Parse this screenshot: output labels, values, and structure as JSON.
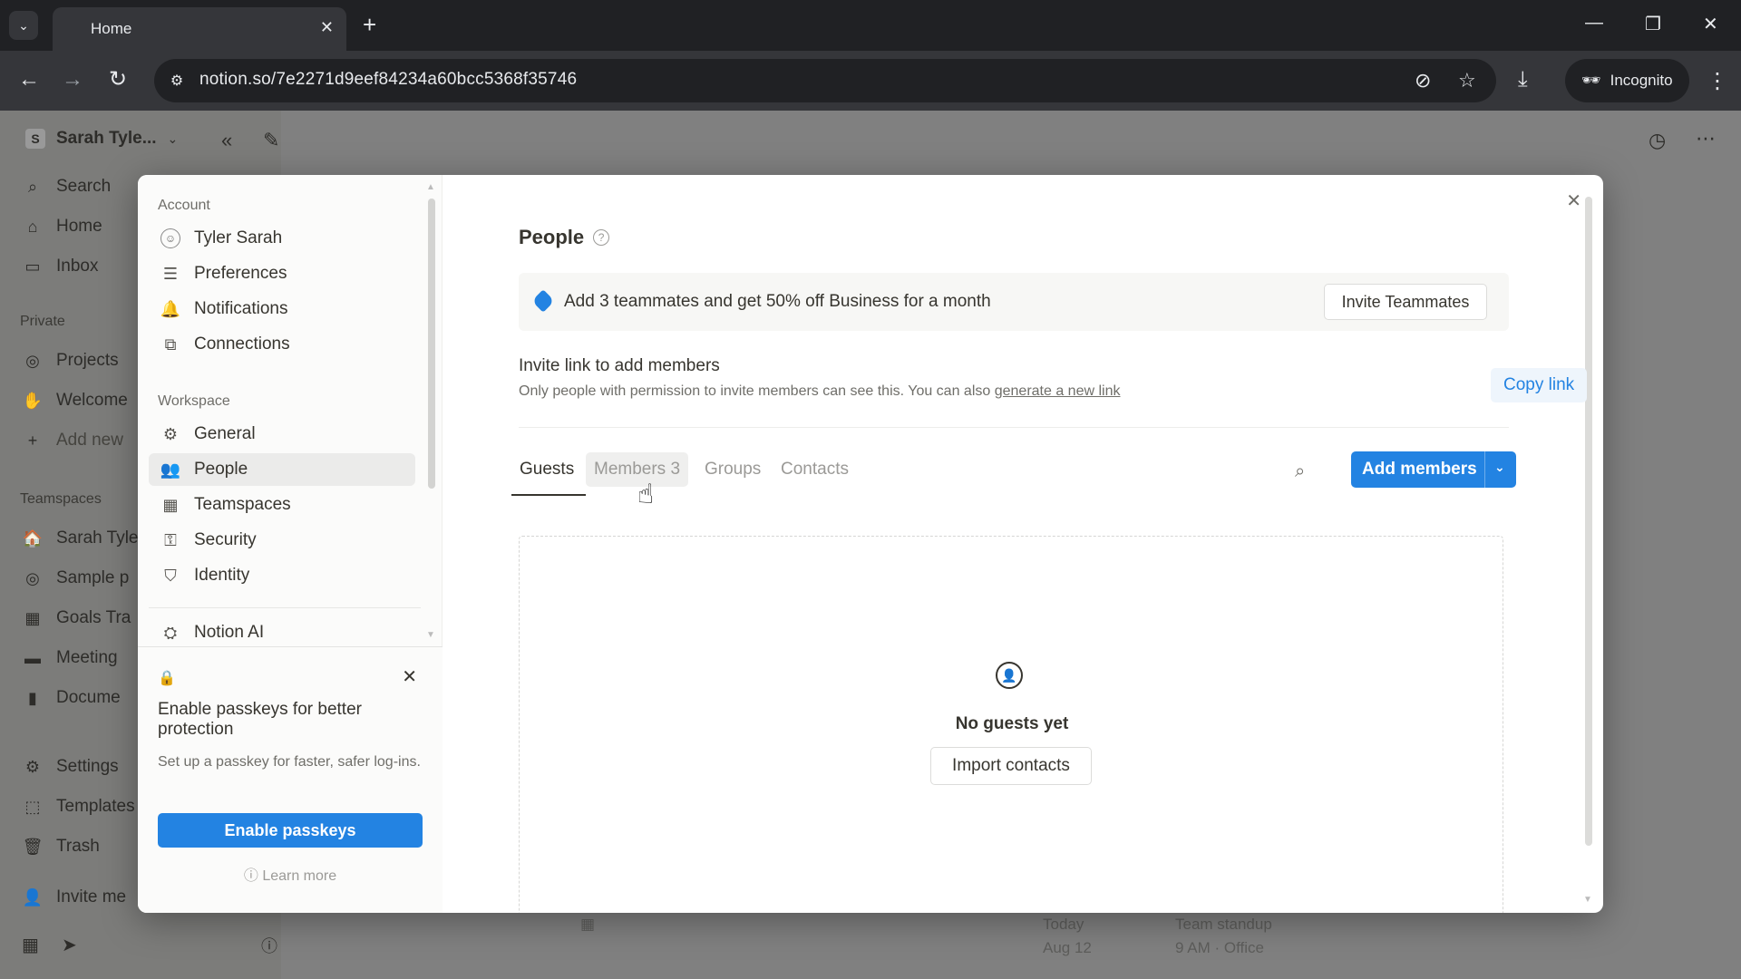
{
  "browser": {
    "tab_title": "Home",
    "url": "notion.so/7e2271d9eef84234a60bcc5368f35746",
    "incognito_label": "Incognito"
  },
  "notion_sidebar": {
    "workspace_name": "Sarah Tyle...",
    "workspace_initial": "S",
    "items": [
      {
        "label": "Search",
        "icon": "search-icon"
      },
      {
        "label": "Home",
        "icon": "home-icon"
      },
      {
        "label": "Inbox",
        "icon": "inbox-icon"
      }
    ],
    "private_label": "Private",
    "private_items": [
      {
        "label": "Projects",
        "icon": "projects-icon"
      },
      {
        "label": "Welcome",
        "icon": "wave-icon"
      },
      {
        "label": "Add new",
        "icon": "plus-icon"
      }
    ],
    "teamspaces_label": "Teamspaces",
    "teamspace_items": [
      {
        "label": "Sarah Tyle",
        "icon": "house-icon"
      },
      {
        "label": "Sample p",
        "icon": "sample-icon"
      },
      {
        "label": "Goals Tra",
        "icon": "chart-icon"
      },
      {
        "label": "Meeting",
        "icon": "folder-icon"
      },
      {
        "label": "Docume",
        "icon": "doc-icon"
      }
    ],
    "bottom_items": [
      {
        "label": "Settings",
        "icon": "gear-icon"
      },
      {
        "label": "Templates",
        "icon": "templates-icon"
      },
      {
        "label": "Trash",
        "icon": "trash-icon"
      },
      {
        "label": "Invite me",
        "icon": "invite-icon"
      }
    ]
  },
  "background_calendar": {
    "today": "Today",
    "date": "Aug 12",
    "event": "Team standup",
    "event_meta": "9 AM · Office"
  },
  "settings_modal": {
    "account_label": "Account",
    "account_items": [
      {
        "label": "Tyler Sarah",
        "icon": "avatar-icon"
      },
      {
        "label": "Preferences",
        "icon": "sliders-icon"
      },
      {
        "label": "Notifications",
        "icon": "bell-icon"
      },
      {
        "label": "Connections",
        "icon": "external-link-icon"
      }
    ],
    "workspace_label": "Workspace",
    "workspace_items": [
      {
        "label": "General",
        "icon": "gear-icon"
      },
      {
        "label": "People",
        "icon": "people-icon"
      },
      {
        "label": "Teamspaces",
        "icon": "teamspaces-icon"
      },
      {
        "label": "Security",
        "icon": "key-icon"
      },
      {
        "label": "Identity",
        "icon": "shield-check-icon"
      },
      {
        "label": "Notion AI",
        "icon": "ai-icon"
      }
    ],
    "passkey": {
      "title": "Enable passkeys for better protection",
      "description": "Set up a passkey for faster, safer log-ins.",
      "button": "Enable passkeys",
      "learn_more": "Learn more"
    },
    "people": {
      "title": "People",
      "promo_text": "Add 3 teammates and get 50% off Business for a month",
      "invite_button": "Invite Teammates",
      "invite_link_title": "Invite link to add members",
      "invite_link_desc": "Only people with permission to invite members can see this. You can also ",
      "invite_link_action": "generate a new link",
      "copy_link": "Copy link",
      "invite_link_enabled": true,
      "tabs": [
        "Guests",
        "Members 3",
        "Groups",
        "Contacts"
      ],
      "active_tab": "Guests",
      "add_members": "Add members",
      "empty_text": "No guests yet",
      "import_button": "Import contacts"
    }
  },
  "colors": {
    "accent": "#2383e2",
    "overlay": "#7f7f7f"
  }
}
